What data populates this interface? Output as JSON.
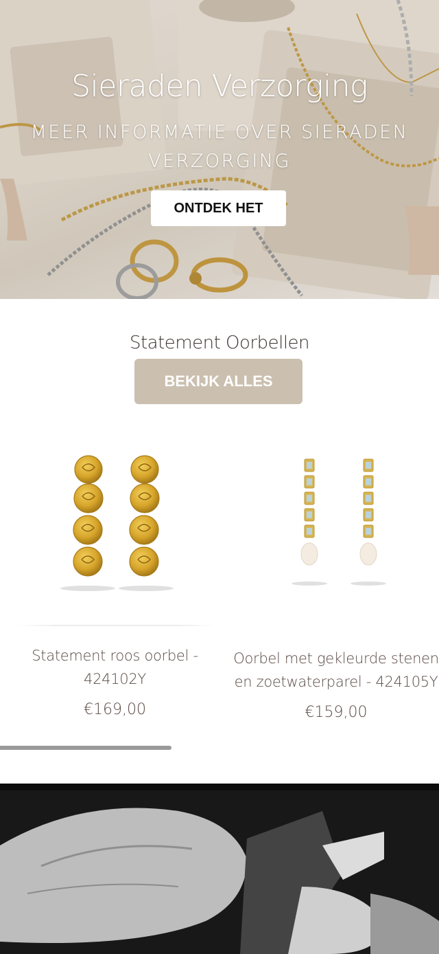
{
  "hero": {
    "title": "Sieraden Verzorging",
    "subtitle": "MEER INFORMATIE OVER SIERADEN VERZORGING",
    "cta_label": "ONTDEK HET"
  },
  "collection": {
    "title": "Statement Oorbellen",
    "view_all_label": "BEKIJK ALLES",
    "products": [
      {
        "name": "Statement roos oorbel - 424102Y",
        "price": "€169,00"
      },
      {
        "name": "Oorbel met gekleurde stenen en zoetwaterparel - 424105Y",
        "price": "€159,00"
      }
    ],
    "scroll_progress": 0.39
  },
  "colors": {
    "accent_button": "#cbbfaf",
    "text_brown": "#5a4a44",
    "gold": "#d4a52a"
  }
}
